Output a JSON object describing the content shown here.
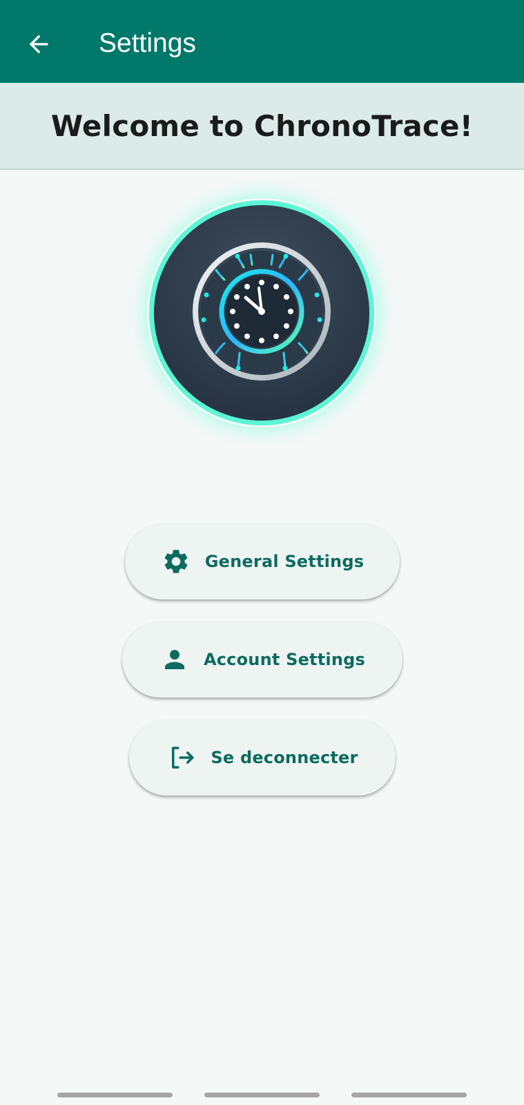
{
  "app_bar": {
    "title": "Settings",
    "back_icon": "arrow-back-icon",
    "background": "#00796b"
  },
  "welcome": {
    "text": "Welcome to ChronoTrace!",
    "background": "#dcebe7"
  },
  "logo": {
    "icon": "chronotrace-clock-circuit-logo",
    "glow_color": "#64ffda"
  },
  "buttons": [
    {
      "label": "General Settings",
      "icon": "gear-icon"
    },
    {
      "label": "Account Settings",
      "icon": "person-icon"
    },
    {
      "label": "Se deconnecter",
      "icon": "logout-icon"
    }
  ],
  "accent_color": "#0d6b5f",
  "system_nav": {
    "pills": 3
  }
}
